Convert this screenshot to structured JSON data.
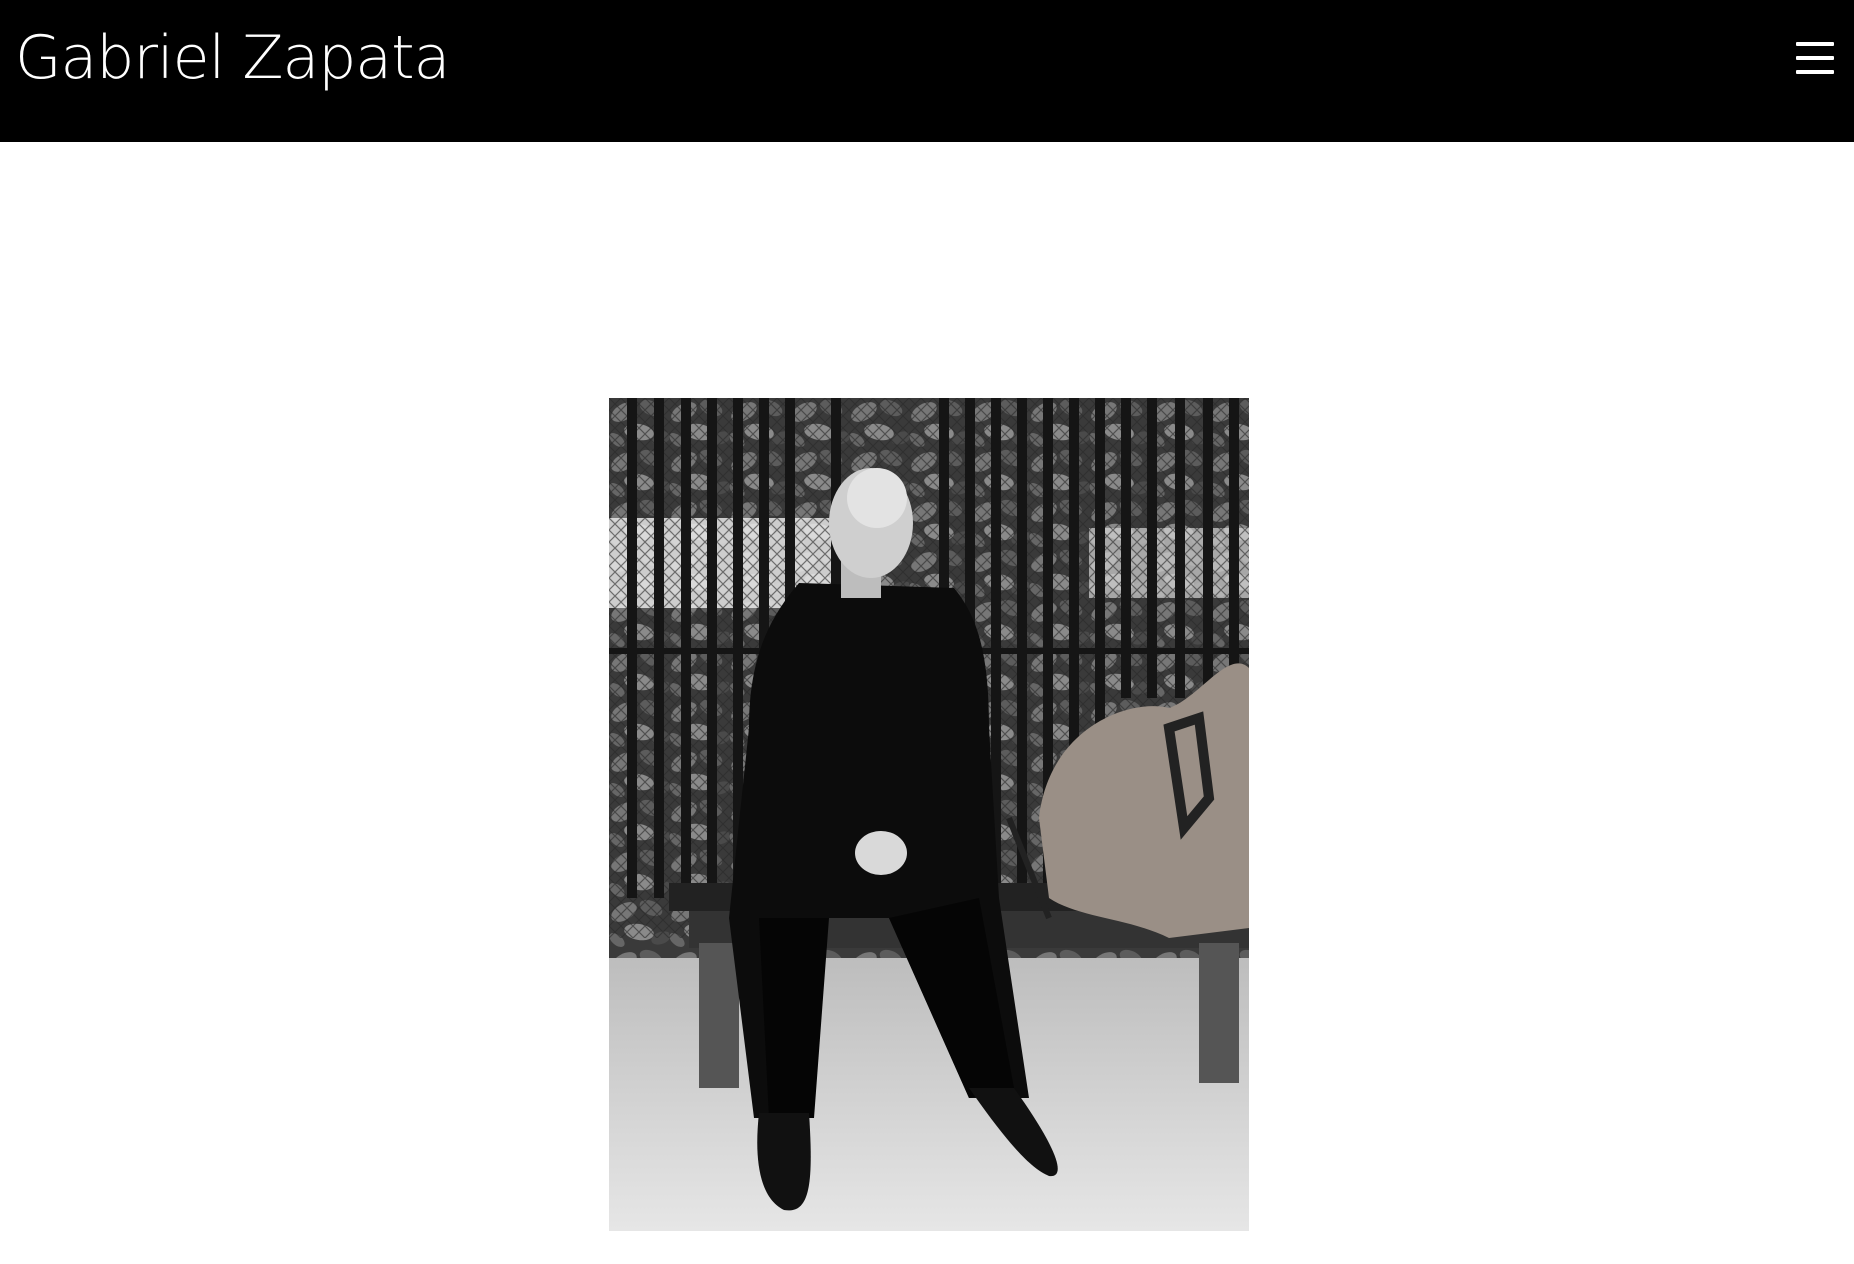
{
  "header": {
    "site_title": "Gabriel Zapata",
    "menu_icon": "hamburger-menu-icon",
    "background_color": "#000000",
    "text_color": "#ffffff"
  },
  "main": {
    "photo": {
      "description_icon": "portrait-photo",
      "style": "black-and-white"
    }
  }
}
